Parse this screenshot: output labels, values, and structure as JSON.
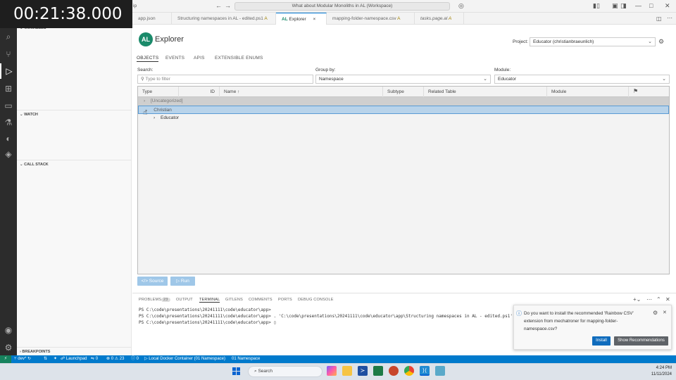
{
  "overlay": {
    "timer": "00:21:38.000"
  },
  "titlebar": {
    "title_partial": "ip",
    "command_center": "What about Modular Monoliths in AL (Workspace)"
  },
  "sidebar": {
    "variables": "VARIABLES",
    "watch": "WATCH",
    "call_stack": "CALL STACK",
    "breakpoints": "BREAKPOINTS"
  },
  "tabs": [
    {
      "label": "app.json",
      "modifier": ""
    },
    {
      "label": "Structuring namespaces in AL - edited.ps1",
      "modifier": "A"
    },
    {
      "label": "Explorer",
      "modifier": "×"
    },
    {
      "label": "mapping-folder-namespace.csv",
      "modifier": "A"
    },
    {
      "label": "tasks.page.al",
      "modifier": "A"
    }
  ],
  "explorer": {
    "logo": "AL",
    "title": "Explorer",
    "project_label": "Project:",
    "project_value": "Educator (christianbraeunlich)",
    "subtabs": [
      "OBJECTS",
      "EVENTS",
      "APIS",
      "EXTENSIBLE ENUMS"
    ],
    "search_label": "Search:",
    "search_placeholder": "Type to filter",
    "group_label": "Group by:",
    "group_value": "Namespace",
    "module_label": "Module:",
    "module_value": "Educator",
    "columns": [
      "Type",
      "ID",
      "Name ↑",
      "Subtype",
      "Related Table",
      "Module"
    ],
    "rows": [
      {
        "label": "[Uncategorized]",
        "level": 0
      },
      {
        "label": "Christian",
        "level": 0
      },
      {
        "label": "Educator",
        "level": 1
      }
    ],
    "source_button": "</> Source",
    "run_button": "▷ Run"
  },
  "panel": {
    "tabs": [
      "PROBLEMS",
      "23",
      "OUTPUT",
      "TERMINAL",
      "GITLENS",
      "COMMENTS",
      "PORTS",
      "DEBUG CONSOLE"
    ],
    "terminal_lines": [
      "PS C:\\code\\presentations\\20241111\\code\\educator\\app>",
      "PS C:\\code\\presentations\\20241111\\code\\educator\\app> . 'C:\\code\\presentations\\20241111\\code\\educator\\app\\Structuring namespaces in AL - edited.ps1'",
      "PS C:\\code\\presentations\\20241111\\code\\educator\\app> ▯"
    ]
  },
  "notification": {
    "message": "Do you want to install the recommended 'Rainbow CSV' extension from mechatroner for mapping-folder-namespace.csv?",
    "install": "Install",
    "show": "Show Recommendations"
  },
  "statusbar": {
    "branch": "dev*",
    "launchpad": "Launchpad",
    "ports": "0",
    "errors": "0",
    "warnings": "23",
    "info": "0",
    "container": "Local Docker Container (01 Namespace)",
    "namespace": "01 Namespace"
  },
  "taskbar": {
    "search": "Search",
    "time": "4:24 PM",
    "date": "11/11/2024"
  },
  "colors": {
    "accent": "#007acc",
    "selection": "#b8d3ea",
    "logo": "#1a8a6a"
  }
}
